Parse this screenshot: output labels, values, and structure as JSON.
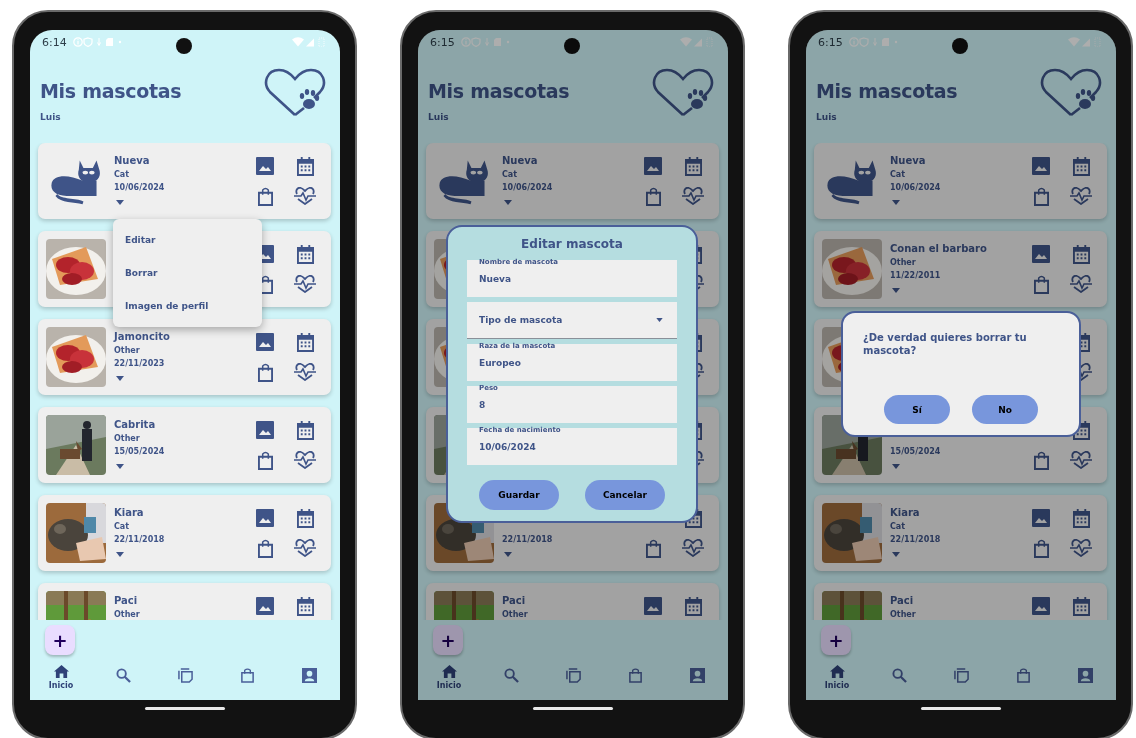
{
  "phones": [
    {
      "status_bar": {
        "time": "6:14"
      },
      "header": {
        "title": "Mis mascotas",
        "user": "Luis"
      },
      "pets": [
        {
          "kind": "icon",
          "name": "Nueva",
          "type": "Cat",
          "birth_date": "10/06/2024",
          "actions": [
            {
              "kind": "gallery"
            },
            {
              "kind": "calendar"
            },
            {
              "kind": "bag"
            },
            {
              "kind": "health"
            }
          ]
        },
        {
          "kind": "picture",
          "actions": [
            {
              "kind": "gallery"
            },
            {
              "kind": "calendar"
            },
            {
              "kind": "bag"
            },
            {
              "kind": "health"
            }
          ]
        },
        {
          "kind": "picture",
          "name": "Jamoncito",
          "type": "Other",
          "birth_date": "22/11/2023",
          "actions": [
            {
              "kind": "gallery"
            },
            {
              "kind": "calendar"
            },
            {
              "kind": "bag"
            },
            {
              "kind": "health"
            }
          ]
        },
        {
          "kind": "picture",
          "name": "Cabrita",
          "type": "Other",
          "birth_date": "15/05/2024",
          "actions": [
            {
              "kind": "gallery"
            },
            {
              "kind": "calendar"
            },
            {
              "kind": "bag"
            },
            {
              "kind": "health"
            }
          ]
        },
        {
          "kind": "picture",
          "name": "Kiara",
          "type": "Cat",
          "birth_date": "22/11/2018",
          "actions": [
            {
              "kind": "gallery"
            },
            {
              "kind": "calendar"
            },
            {
              "kind": "bag"
            },
            {
              "kind": "health"
            }
          ]
        },
        {
          "kind": "picture",
          "name": "Paci",
          "type": "Other",
          "actions": [
            {
              "kind": "gallery"
            },
            {
              "kind": "calendar"
            }
          ]
        }
      ],
      "fab": {
        "label": "+"
      },
      "bottom_nav": [
        {
          "kind": "home",
          "label": "Inicio",
          "selected": true
        },
        {
          "kind": "search",
          "selected": false
        },
        {
          "kind": "copy",
          "selected": false
        },
        {
          "kind": "bag",
          "selected": false
        },
        {
          "kind": "profile",
          "selected": false
        }
      ],
      "overlay": {
        "kind": "menu",
        "items": [
          "Editar",
          "Borrar",
          "Imagen de perfil"
        ]
      }
    },
    {
      "status_bar": {
        "time": "6:15"
      },
      "header": {
        "title": "Mis mascotas",
        "user": "Luis"
      },
      "pets": [
        {
          "kind": "icon",
          "name": "Nueva",
          "type": "Cat",
          "birth_date": "10/06/2024",
          "actions": [
            {
              "kind": "gallery"
            },
            {
              "kind": "calendar"
            },
            {
              "kind": "bag"
            },
            {
              "kind": "health"
            }
          ]
        },
        {
          "kind": "picture",
          "actions": [
            {
              "kind": "calendar"
            },
            {
              "kind": "health"
            }
          ]
        },
        {
          "kind": "picture",
          "actions": [
            {
              "kind": "calendar"
            },
            {
              "kind": "health"
            }
          ]
        },
        {
          "kind": "picture",
          "actions": [
            {
              "kind": "calendar"
            },
            {
              "kind": "health"
            }
          ]
        },
        {
          "kind": "picture",
          "birth_date": "22/11/2018",
          "actions": [
            {
              "kind": "calendar"
            },
            {
              "kind": "bag"
            },
            {
              "kind": "health"
            }
          ]
        },
        {
          "kind": "picture",
          "name": "Paci",
          "type": "Other",
          "actions": [
            {
              "kind": "gallery"
            },
            {
              "kind": "calendar"
            }
          ]
        }
      ],
      "fab": {
        "label": "+"
      },
      "bottom_nav": [
        {
          "kind": "home",
          "label": "Inicio",
          "selected": true
        },
        {
          "kind": "search",
          "selected": false
        },
        {
          "kind": "copy",
          "selected": false
        },
        {
          "kind": "bag",
          "selected": false
        },
        {
          "kind": "profile",
          "selected": false
        }
      ],
      "overlay": {
        "kind": "edit_dialog",
        "title": "Editar mascota",
        "fields": [
          {
            "kind": "text",
            "label": "Nombre de mascota",
            "value": "Nueva"
          },
          {
            "kind": "select",
            "label": "Tipo de mascota"
          },
          {
            "kind": "text",
            "label": "Raza de la mascota",
            "value": "Europeo"
          },
          {
            "kind": "text",
            "label": "Peso",
            "value": "8"
          },
          {
            "kind": "text",
            "label": "Fecha de nacimiento",
            "value": "10/06/2024"
          }
        ],
        "buttons": [
          "Guardar",
          "Cancelar"
        ]
      }
    },
    {
      "status_bar": {
        "time": "6:15"
      },
      "header": {
        "title": "Mis mascotas",
        "user": "Luis"
      },
      "pets": [
        {
          "kind": "icon",
          "name": "Nueva",
          "type": "Cat",
          "birth_date": "10/06/2024",
          "actions": [
            {
              "kind": "gallery"
            },
            {
              "kind": "calendar"
            },
            {
              "kind": "bag"
            },
            {
              "kind": "health"
            }
          ]
        },
        {
          "kind": "picture",
          "name": "Conan el barbaro",
          "type": "Other",
          "birth_date": "11/22/2011",
          "actions": [
            {
              "kind": "gallery"
            },
            {
              "kind": "calendar"
            },
            {
              "kind": "bag"
            },
            {
              "kind": "health"
            }
          ]
        },
        {
          "kind": "picture",
          "actions": [
            {
              "kind": "calendar"
            },
            {
              "kind": "health"
            }
          ]
        },
        {
          "kind": "picture",
          "birth_date": "15/05/2024",
          "actions": [
            {
              "kind": "calendar"
            },
            {
              "kind": "bag"
            },
            {
              "kind": "health"
            }
          ]
        },
        {
          "kind": "picture",
          "name": "Kiara",
          "type": "Cat",
          "birth_date": "22/11/2018",
          "actions": [
            {
              "kind": "gallery"
            },
            {
              "kind": "calendar"
            },
            {
              "kind": "bag"
            },
            {
              "kind": "health"
            }
          ]
        },
        {
          "kind": "picture",
          "name": "Paci",
          "type": "Other",
          "actions": [
            {
              "kind": "gallery"
            },
            {
              "kind": "calendar"
            }
          ]
        }
      ],
      "fab": {
        "label": "+"
      },
      "bottom_nav": [
        {
          "kind": "home",
          "label": "Inicio",
          "selected": true
        },
        {
          "kind": "search",
          "selected": false
        },
        {
          "kind": "copy",
          "selected": false
        },
        {
          "kind": "bag",
          "selected": false
        },
        {
          "kind": "profile",
          "selected": false
        }
      ],
      "overlay": {
        "kind": "confirm_dialog",
        "message": "¿De verdad quieres borrar tu mascota?",
        "buttons": [
          "Sí",
          "No"
        ]
      }
    }
  ]
}
